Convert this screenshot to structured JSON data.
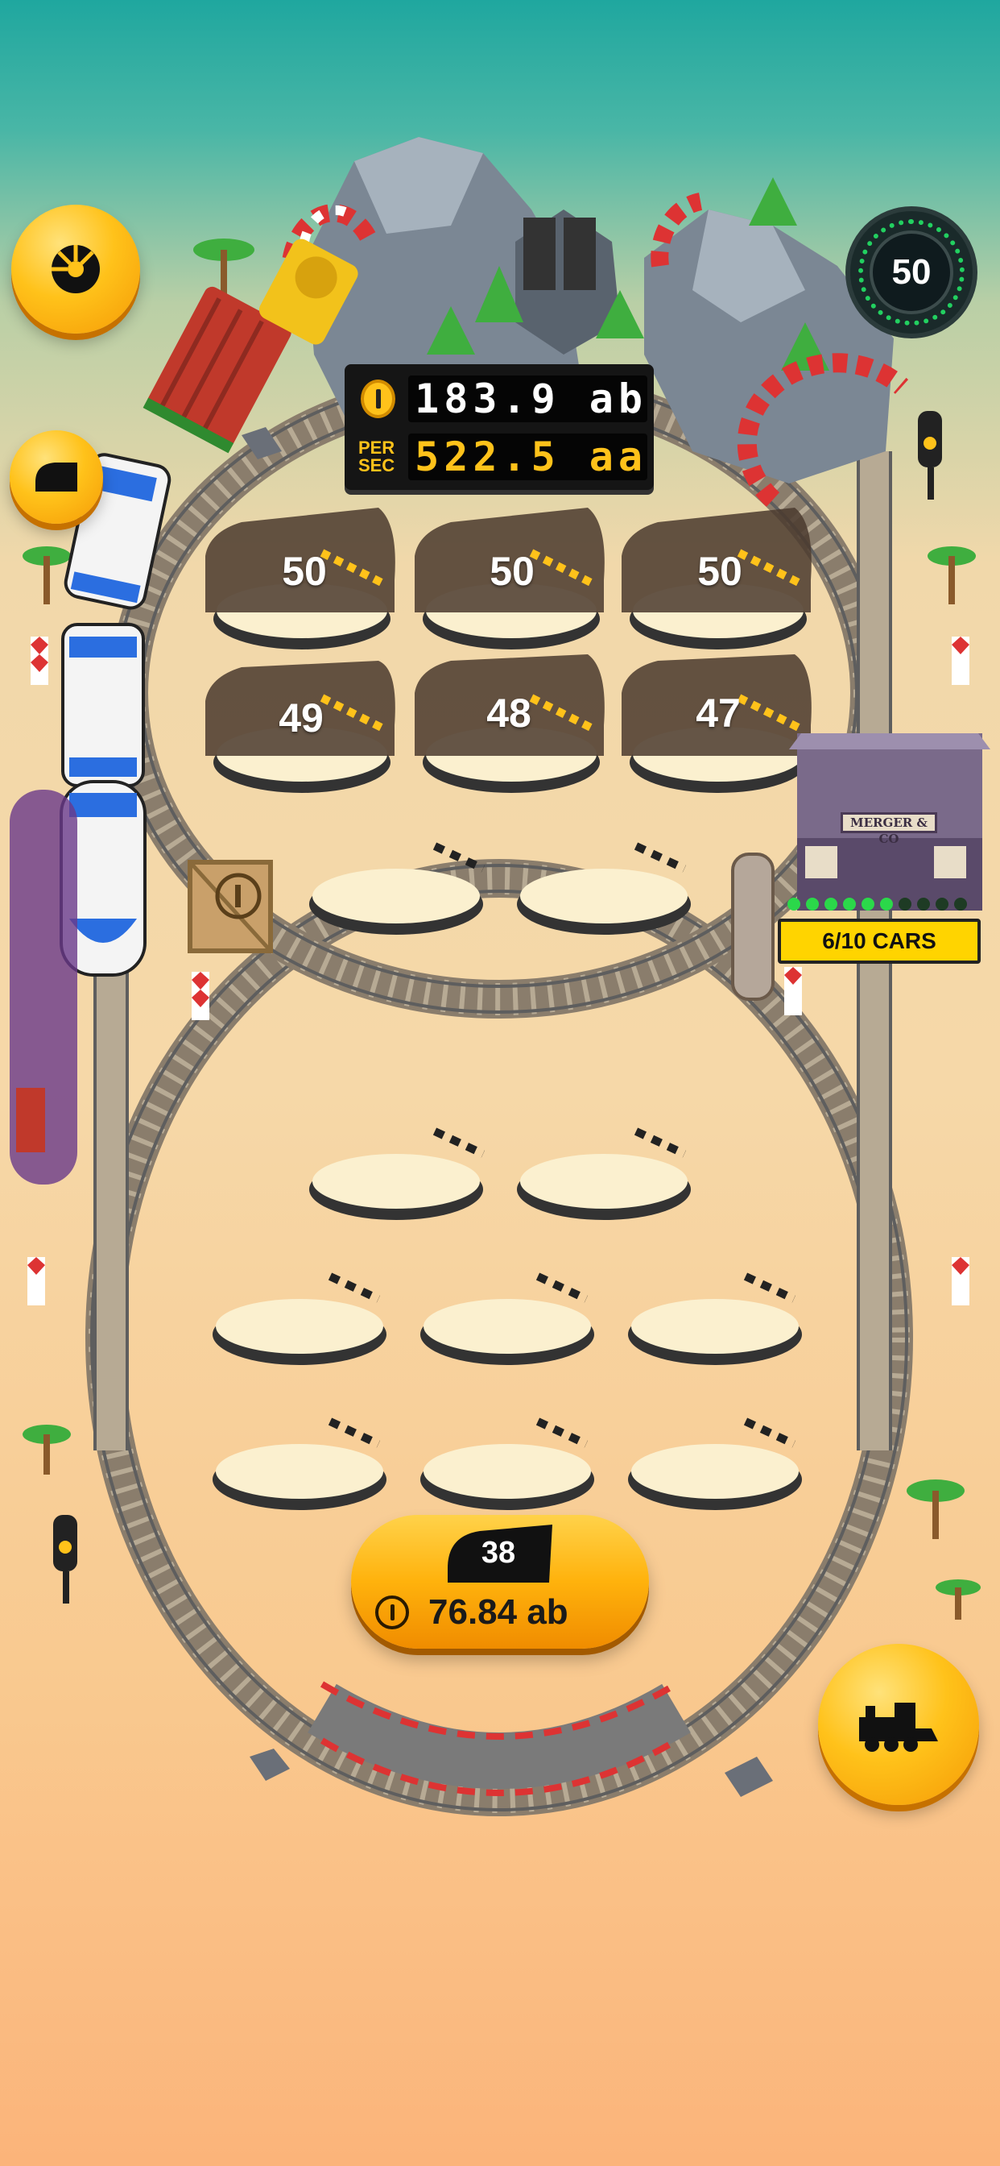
{
  "hud": {
    "coins": "183.9 ab",
    "per_sec_label": "PER\nSEC",
    "per_sec_value": "522.5 aa",
    "level": "50"
  },
  "slots": [
    {
      "level": "50",
      "occupied": true
    },
    {
      "level": "50",
      "occupied": true
    },
    {
      "level": "50",
      "occupied": true
    },
    {
      "level": "49",
      "occupied": true
    },
    {
      "level": "48",
      "occupied": true
    },
    {
      "level": "47",
      "occupied": true
    },
    {
      "level": "",
      "occupied": false
    },
    {
      "level": "",
      "occupied": false
    },
    {
      "level": "",
      "occupied": false
    },
    {
      "level": "",
      "occupied": false
    },
    {
      "level": "",
      "occupied": false
    },
    {
      "level": "",
      "occupied": false
    },
    {
      "level": "",
      "occupied": false
    },
    {
      "level": "",
      "occupied": false
    },
    {
      "level": "",
      "occupied": false
    },
    {
      "level": "",
      "occupied": false
    }
  ],
  "depot": {
    "name": "MERGER & CO",
    "cars": "6/10 CARS",
    "capacity_lights": {
      "filled": 6,
      "total": 10
    }
  },
  "buy": {
    "level": "38",
    "cost": "76.84 ab"
  },
  "icons": {
    "top_left_button": "wheel-icon",
    "left_button": "locomotive-icon",
    "bottom_right_button": "steam-train-icon"
  },
  "colors": {
    "accent_yellow": "#ffc21a",
    "sky_teal": "#1fa79f",
    "sand": "#f6d8a8"
  }
}
